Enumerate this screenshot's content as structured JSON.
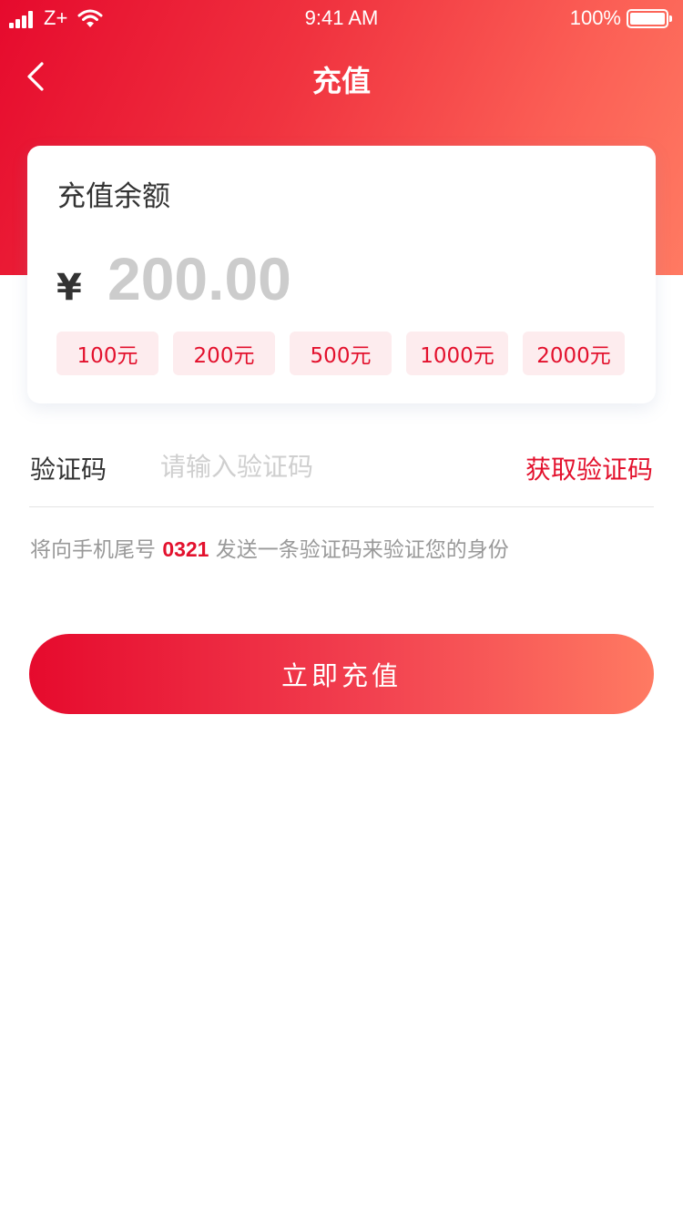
{
  "status_bar": {
    "carrier": "Z+",
    "time": "9:41 AM",
    "battery": "100%"
  },
  "nav": {
    "title": "充值",
    "back_icon": "chevron-left-icon"
  },
  "balance_card": {
    "title": "充值余额",
    "currency_symbol": "¥",
    "amount_placeholder": "200.00",
    "amount_value": "",
    "quick_amounts": [
      "100元",
      "200元",
      "500元",
      "1000元",
      "2000元"
    ]
  },
  "verification": {
    "label": "验证码",
    "placeholder": "请输入验证码",
    "get_code_label": "获取验证码",
    "hint_prefix": "将向手机尾号 ",
    "phone_tail": "0321",
    "hint_suffix": " 发送一条验证码来验证您的身份"
  },
  "submit": {
    "label": "立即充值"
  },
  "colors": {
    "brand_red": "#e3112d",
    "gradient_start": "#e60a2d",
    "gradient_end": "#ff7a62",
    "chip_bg": "#fdecee",
    "placeholder_gray": "#cccccc",
    "hint_gray": "#999999"
  }
}
